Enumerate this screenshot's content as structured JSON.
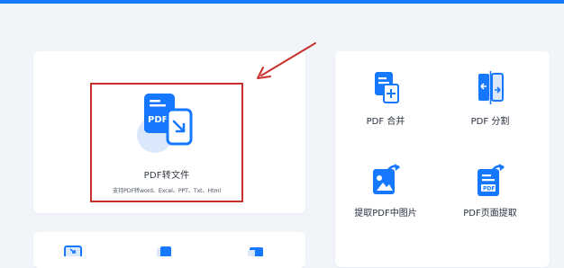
{
  "main_tool": {
    "title": "PDF转文件",
    "description": "支持PDF转word、Excel、PPT、Txt、Html",
    "icon_text": "PDF"
  },
  "tools": [
    {
      "label": "PDF 合并",
      "icon": "pdf-merge-icon"
    },
    {
      "label": "PDF 分割",
      "icon": "pdf-split-icon"
    },
    {
      "label": "提取PDF中图片",
      "icon": "extract-image-icon"
    },
    {
      "label": "PDF页面提取",
      "icon": "extract-page-icon"
    }
  ],
  "bottom_icons": [
    "pdf-tool-icon",
    "pdf-tool-icon",
    "pdf-tool-icon"
  ],
  "colors": {
    "accent": "#1677ff",
    "annotation": "#c9302c",
    "icon_light": "#dbe8fb",
    "card": "#ffffff",
    "page_bg": "#f1f4f9"
  }
}
